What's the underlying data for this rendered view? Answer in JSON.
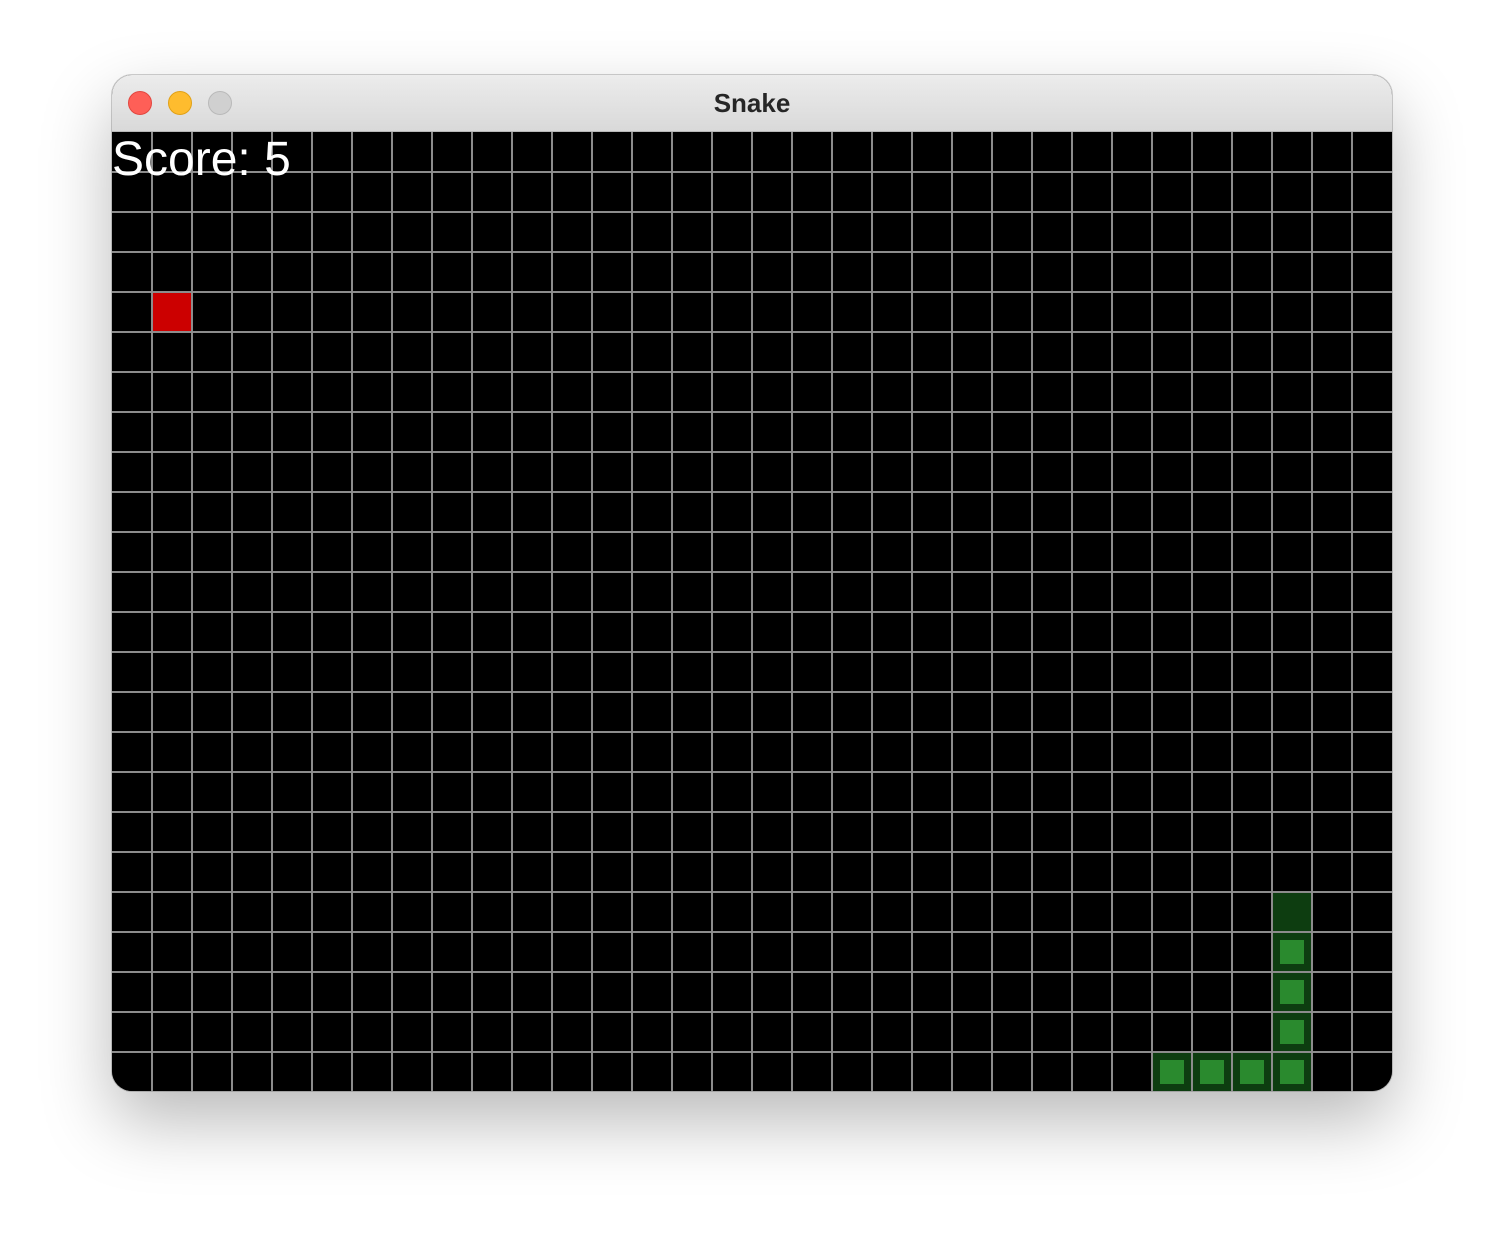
{
  "window": {
    "title": "Snake"
  },
  "game": {
    "score_text": "Score: 5",
    "grid": {
      "cols": 32,
      "rows": 24
    },
    "food": {
      "col": 1,
      "row": 4
    },
    "snake": {
      "head": {
        "col": 29,
        "row": 19
      },
      "segments": [
        {
          "col": 29,
          "row": 20
        },
        {
          "col": 29,
          "row": 21
        },
        {
          "col": 29,
          "row": 22
        },
        {
          "col": 29,
          "row": 23
        },
        {
          "col": 28,
          "row": 23
        },
        {
          "col": 27,
          "row": 23
        },
        {
          "col": 26,
          "row": 23
        }
      ]
    },
    "colors": {
      "background": "#000000",
      "grid_line": "#8c8c8c",
      "food": "#cc0000",
      "snake_cell": "#0d3d10",
      "snake_inner": "#2a8a2e"
    }
  }
}
